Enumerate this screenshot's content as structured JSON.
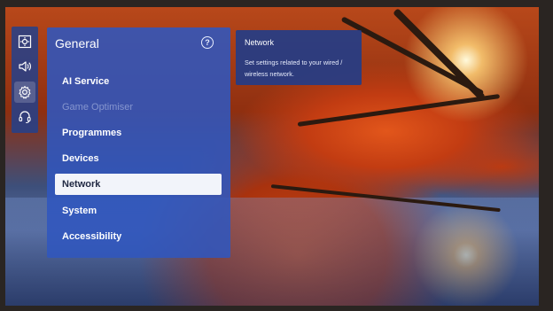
{
  "colors": {
    "panel_bg": "#3056be",
    "selected_bg": "#f2f4fa",
    "selected_text": "#222a44",
    "text": "#ffffff"
  },
  "rail": {
    "items": [
      {
        "icon": "picture-settings-icon"
      },
      {
        "icon": "speaker-icon"
      },
      {
        "icon": "gear-icon",
        "active": true
      },
      {
        "icon": "headset-support-icon"
      }
    ]
  },
  "panel": {
    "title": "General",
    "help_icon": "?",
    "items": [
      {
        "label": "AI Service"
      },
      {
        "label": "Game Optimiser",
        "disabled": true
      },
      {
        "label": "Programmes"
      },
      {
        "label": "Devices"
      },
      {
        "label": "Network",
        "selected": true
      },
      {
        "label": "System"
      },
      {
        "label": "Accessibility"
      }
    ]
  },
  "tooltip": {
    "title": "Network",
    "description": "Set settings related to your wired / wireless network."
  }
}
